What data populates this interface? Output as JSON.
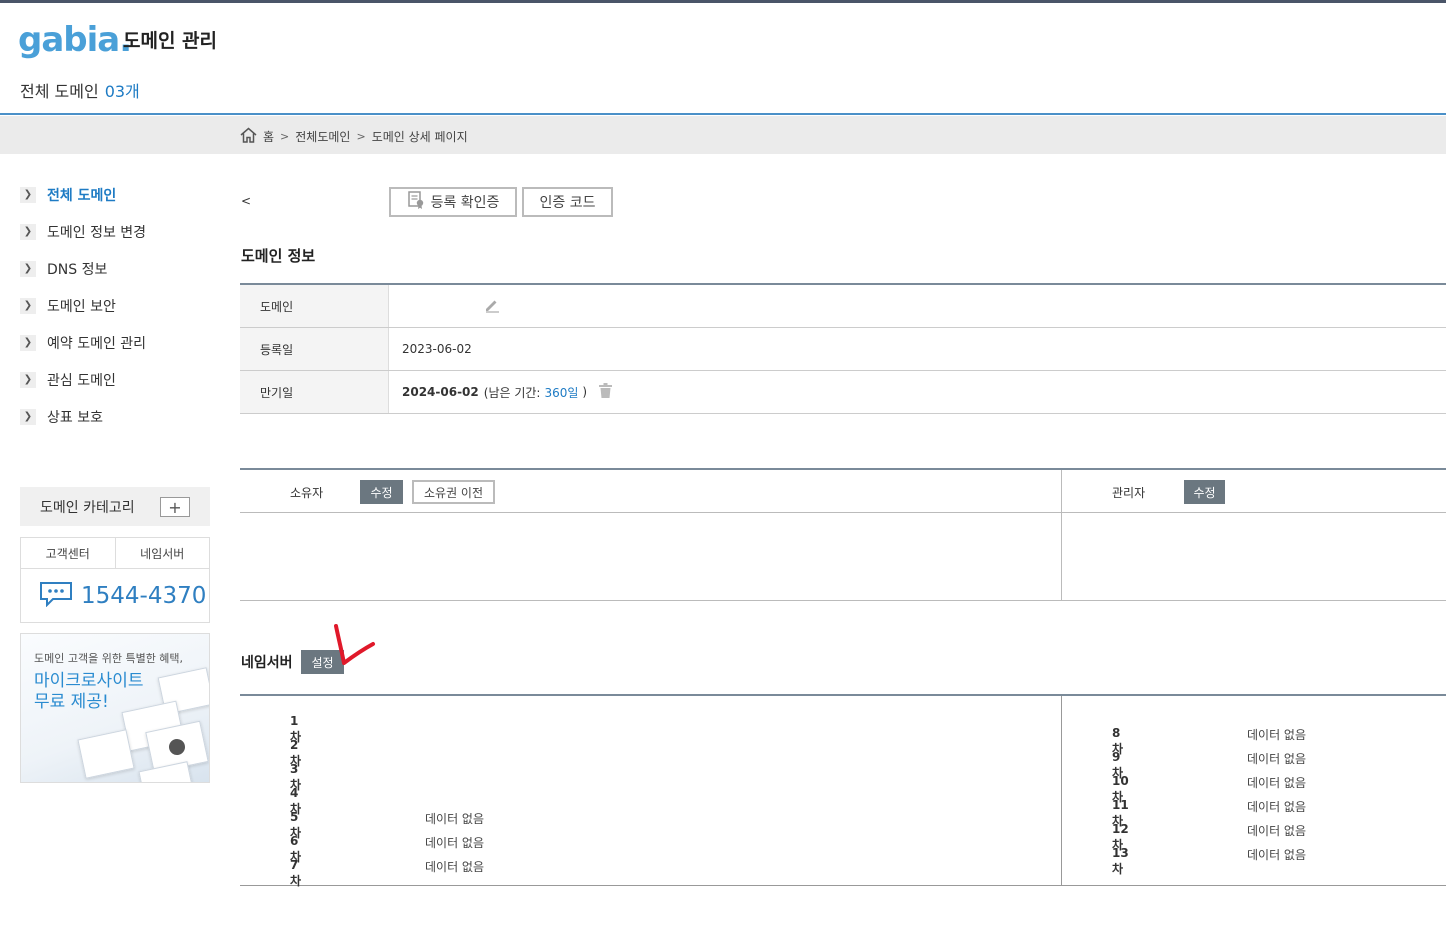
{
  "header": {
    "logo": "gabia.",
    "title": "도메인 관리",
    "total_label": "전체 도메인",
    "total_count": "03개"
  },
  "breadcrumb": {
    "home": "홈",
    "sep": ">",
    "level1": "전체도메인",
    "level2": "도메인 상세 페이지"
  },
  "sidebar": {
    "items": [
      {
        "label": "전체 도메인"
      },
      {
        "label": "도메인 정보 변경"
      },
      {
        "label": "DNS 정보"
      },
      {
        "label": "도메인 보안"
      },
      {
        "label": "예약 도메인 관리"
      },
      {
        "label": "관심 도메인"
      },
      {
        "label": "상표 보호"
      }
    ],
    "category_label": "도메인 카테고리",
    "help_tabs": [
      "고객센터",
      "네임서버"
    ],
    "phone": "1544-4370",
    "promo_small": "도메인 고객을 위한 특별한 혜택,",
    "promo_big_1": "마이크로사이트",
    "promo_big_2": "무료 제공!"
  },
  "toolbar": {
    "back": "<",
    "cert_button": "등록 확인증",
    "auth_button": "인증 코드"
  },
  "domain_info": {
    "title": "도메인 정보",
    "rows": {
      "domain_label": "도메인",
      "domain_value": "",
      "reg_label": "등록일",
      "reg_value": "2023-06-02",
      "exp_label": "만기일",
      "exp_value": "2024-06-02",
      "remain_prefix": "(남은 기간:",
      "remain_days": "360일",
      "remain_suffix": ")"
    }
  },
  "contacts": {
    "owner_label": "소유자",
    "owner_edit": "수정",
    "owner_transfer": "소유권 이전",
    "admin_label": "관리자",
    "admin_edit": "수정"
  },
  "nameserver": {
    "title": "네임서버",
    "set_button": "설정",
    "left": [
      {
        "k": "1차",
        "v": ""
      },
      {
        "k": "2차",
        "v": ""
      },
      {
        "k": "3차",
        "v": ""
      },
      {
        "k": "4차",
        "v": ""
      },
      {
        "k": "5차",
        "v": "데이터 없음"
      },
      {
        "k": "6차",
        "v": "데이터 없음"
      },
      {
        "k": "7차",
        "v": "데이터 없음"
      }
    ],
    "right": [
      {
        "k": "8차",
        "v": "데이터 없음"
      },
      {
        "k": "9차",
        "v": "데이터 없음"
      },
      {
        "k": "10차",
        "v": "데이터 없음"
      },
      {
        "k": "11차",
        "v": "데이터 없음"
      },
      {
        "k": "12차",
        "v": "데이터 없음"
      },
      {
        "k": "13차",
        "v": "데이터 없음"
      }
    ]
  },
  "colors": {
    "brand": "#4aa0d8",
    "link": "#1e7bc4",
    "dark_button": "#6b7780",
    "annotation": "#e0192a"
  }
}
